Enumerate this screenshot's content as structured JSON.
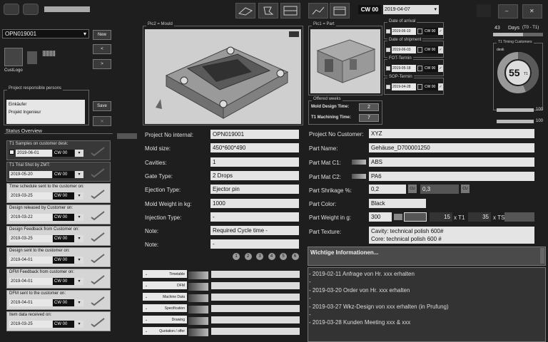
{
  "app": {
    "cw_label": "CW 00",
    "cw_date": "2019-04-07"
  },
  "left": {
    "project_select": "OPN019001",
    "new_label": "New",
    "prev_label": "<",
    "next_label": ">",
    "cust_logo_label": "CustLogo",
    "responsible": {
      "title": "Project responsible persons",
      "lines": [
        "Einkäufer",
        "Projekt Ingenieur"
      ],
      "save_label": "Save"
    },
    "status_title": "Status Overview",
    "status_items": [
      {
        "label": "T1 Samples on customer desk:",
        "date": "2019-06-01",
        "cw": "CW 00",
        "dd": "▾"
      },
      {
        "label": "T1 Trial Shot by ZMT:",
        "date": "2019-05-20",
        "cw": "CW 00",
        "dd": "▾"
      },
      {
        "label": "Time schedule sent to the customer on:",
        "date": "2019-03-25",
        "cw": "CW 00",
        "dd": "▾"
      },
      {
        "label": "Design released by Customer on:",
        "date": "2019-03-22",
        "cw": "CW 00",
        "dd": "▾"
      },
      {
        "label": "Design Feedback from Customer on:",
        "date": "2019-03-25",
        "cw": "CW 00",
        "dd": "▾"
      },
      {
        "label": "Design sent to the customer on:",
        "date": "2019-04-01",
        "cw": "CW 00",
        "dd": "▾"
      },
      {
        "label": "DFM Feedback from customer on:",
        "date": "2019-04-01",
        "cw": "CW 00",
        "dd": "▾"
      },
      {
        "label": "DFM sent to the customer on:",
        "date": "2019-04-01",
        "cw": "CW 00",
        "dd": "▾"
      },
      {
        "label": "Item data received on:",
        "date": "2019-03-25",
        "cw": "CW 00",
        "dd": "▾"
      }
    ]
  },
  "pics": {
    "mould_label": "Pic2 = Mould",
    "part_label": "Pic1 = Part"
  },
  "offered": {
    "title": "Offered weeks",
    "design_label": "Mold Design Time:",
    "design_value": "2",
    "machining_label": "T1 Machining Time:",
    "machining_value": "7"
  },
  "dates": [
    {
      "title": "Date of arrival",
      "date": "2019-06-10",
      "cw": "CW 00"
    },
    {
      "title": "Date of shipment",
      "date": "2019-06-03",
      "cw": "CW 00"
    },
    {
      "title": "FOT-Termin",
      "date": "2019-05-18",
      "cw": "CW 00"
    },
    {
      "title": "SOP-Termin",
      "date": "2019-04-28",
      "cw": "CW 00"
    }
  ],
  "right_panel": {
    "week_left": "43",
    "week_label": "Days",
    "week_sub": "(T0 - T1)",
    "timeline_label": "T1 Timing Customers",
    "timeline_sub": "desk",
    "gauge_value": "55",
    "gauge_unit": "T1",
    "bar1_value": "100",
    "bar2_value": "100"
  },
  "form_left": {
    "rows": [
      {
        "label": "Project No internal:",
        "value": "OPN019001"
      },
      {
        "label": "Mold size:",
        "value": "450*600*490"
      },
      {
        "label": "Cavities:",
        "value": "1"
      },
      {
        "label": "Gate Type:",
        "value": "2 Drops"
      },
      {
        "label": "Ejection Type:",
        "value": "Ejector pin"
      },
      {
        "label": "Mold Weight in kg:",
        "value": "1000"
      },
      {
        "label": "Injection Type:",
        "value": "-"
      },
      {
        "label": "Note:",
        "value": "Required Cycle time -"
      },
      {
        "label": "Note:",
        "value": "-"
      }
    ],
    "circles": [
      "1",
      "2",
      "3",
      "4",
      "5",
      "6"
    ]
  },
  "form_right": {
    "project_customer_label": "Project No Customer:",
    "project_customer_value": "XYZ",
    "part_name_label": "Part Name:",
    "part_name_value": "Gehäuse_D700001250",
    "mat_c1_label": "Part Mat C1:",
    "mat_c1_value": "ABS",
    "mat_c2_label": "Part Mat C2:",
    "mat_c2_value": "PA6",
    "shrink_label": "Part Shrikage %:",
    "shrink_value1": "0,2",
    "shrink_value2": "0,3",
    "shrink_btn": "CU",
    "color_label": "Part Color:",
    "color_value": "Black",
    "weight_label": "Part Weight in g:",
    "weight_value": "300",
    "weight_t1_num": "15",
    "weight_t1_label": "x T1",
    "weight_ts_num": "35",
    "weight_ts_label": "x TS",
    "texture_label": "Part Texture:",
    "texture_line1": "Cavity: technical polish 600#",
    "texture_line2": "Core:   technical polish 600 #"
  },
  "info": {
    "title": "Wichtige Informationen...",
    "lines": [
      "- 2019-02-11 Anfrage von Hr. xxx erhalten",
      "-",
      "- 2019-03-20 Order von Hr. xxx erhalten",
      "-",
      "- 2019-03-27 Wkz-Design von xxx erhalten (in Prufung)",
      "-",
      "- 2019-03-28 Kunden Meeting xxx & xxx"
    ]
  },
  "docs": [
    "Timetable",
    "DFM",
    "Machine Data",
    "Specification",
    "Drawing",
    "Quotation / offer"
  ]
}
